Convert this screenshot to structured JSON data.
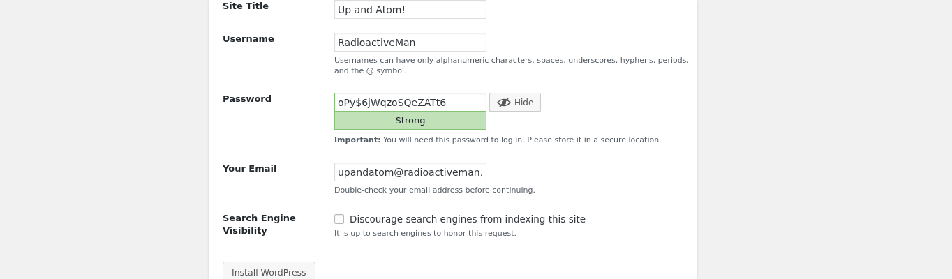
{
  "fields": [
    {
      "kind": "text",
      "label": "Site Title",
      "value": "Up and Atom!"
    },
    {
      "kind": "text",
      "label": "Username",
      "value": "RadioactiveMan",
      "description": "Usernames can have only alphanumeric characters, spaces, underscores, hyphens, periods, and the @ symbol."
    },
    {
      "kind": "password",
      "label": "Password",
      "value": "oPy$6jWqzoSQeZATt6",
      "toggle_button": "Hide",
      "strength": {
        "label": "Strong",
        "kind": "strong"
      },
      "description": "**Important:** You will need this password to log in. Please store it in a secure location."
    },
    {
      "kind": "text",
      "label": "Your Email",
      "value": "upandatom@radioactiveman.",
      "description": "Double-check your email address before continuing."
    },
    {
      "kind": "checkbox",
      "label": "Search Engine Visibility",
      "option": "Discourage search engines from indexing this site",
      "checked": false,
      "description": "It is up to search engines to honor this request."
    }
  ],
  "submit_button": "Install WordPress"
}
